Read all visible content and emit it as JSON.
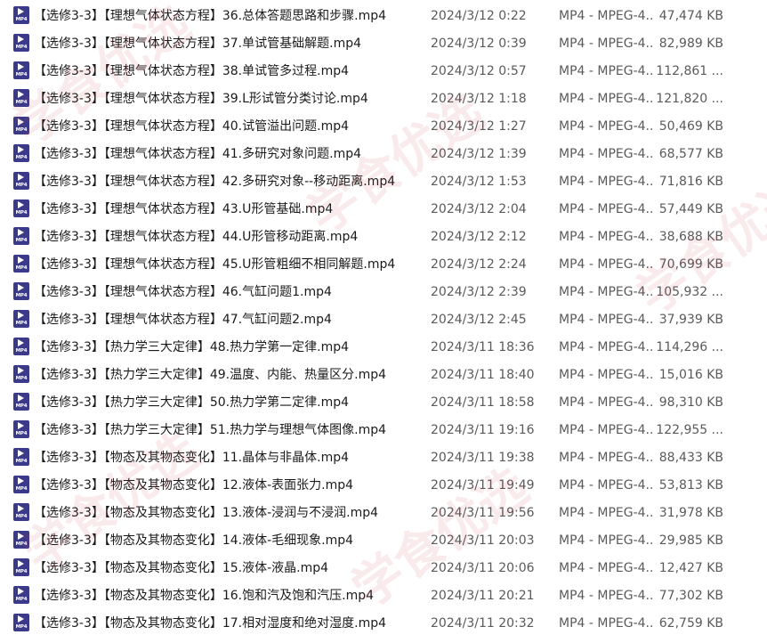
{
  "icon": {
    "name": "mp4-file-icon",
    "label": "MP4",
    "color": "#3b3a8a"
  },
  "files": [
    {
      "name": "【选修3-3】【理想气体状态方程】36.总体答题思路和步骤.mp4",
      "date": "2024/3/12 0:22",
      "type": "MP4 - MPEG-4...",
      "size": "47,474 KB"
    },
    {
      "name": "【选修3-3】【理想气体状态方程】37.单试管基础解题.mp4",
      "date": "2024/3/12 0:39",
      "type": "MP4 - MPEG-4...",
      "size": "82,989 KB"
    },
    {
      "name": "【选修3-3】【理想气体状态方程】38.单试管多过程.mp4",
      "date": "2024/3/12 0:57",
      "type": "MP4 - MPEG-4...",
      "size": "112,861 ..."
    },
    {
      "name": "【选修3-3】【理想气体状态方程】39.L形试管分类讨论.mp4",
      "date": "2024/3/12 1:18",
      "type": "MP4 - MPEG-4...",
      "size": "121,820 ..."
    },
    {
      "name": "【选修3-3】【理想气体状态方程】40.试管溢出问题.mp4",
      "date": "2024/3/12 1:27",
      "type": "MP4 - MPEG-4...",
      "size": "50,469 KB"
    },
    {
      "name": "【选修3-3】【理想气体状态方程】41.多研究对象问题.mp4",
      "date": "2024/3/12 1:39",
      "type": "MP4 - MPEG-4...",
      "size": "68,577 KB"
    },
    {
      "name": "【选修3-3】【理想气体状态方程】42.多研究对象--移动距离.mp4",
      "date": "2024/3/12 1:53",
      "type": "MP4 - MPEG-4...",
      "size": "71,816 KB"
    },
    {
      "name": "【选修3-3】【理想气体状态方程】43.U形管基础.mp4",
      "date": "2024/3/12 2:04",
      "type": "MP4 - MPEG-4...",
      "size": "57,449 KB"
    },
    {
      "name": "【选修3-3】【理想气体状态方程】44.U形管移动距离.mp4",
      "date": "2024/3/12 2:12",
      "type": "MP4 - MPEG-4...",
      "size": "38,688 KB"
    },
    {
      "name": "【选修3-3】【理想气体状态方程】45.U形管粗细不相同解题.mp4",
      "date": "2024/3/12 2:24",
      "type": "MP4 - MPEG-4...",
      "size": "70,699 KB"
    },
    {
      "name": "【选修3-3】【理想气体状态方程】46.气缸问题1.mp4",
      "date": "2024/3/12 2:39",
      "type": "MP4 - MPEG-4...",
      "size": "105,932 ..."
    },
    {
      "name": "【选修3-3】【理想气体状态方程】47.气缸问题2.mp4",
      "date": "2024/3/12 2:45",
      "type": "MP4 - MPEG-4...",
      "size": "37,939 KB"
    },
    {
      "name": "【选修3-3】【热力学三大定律】48.热力学第一定律.mp4",
      "date": "2024/3/11 18:36",
      "type": "MP4 - MPEG-4...",
      "size": "114,296 ..."
    },
    {
      "name": "【选修3-3】【热力学三大定律】49.温度、内能、热量区分.mp4",
      "date": "2024/3/11 18:40",
      "type": "MP4 - MPEG-4...",
      "size": "15,016 KB"
    },
    {
      "name": "【选修3-3】【热力学三大定律】50.热力学第二定律.mp4",
      "date": "2024/3/11 18:58",
      "type": "MP4 - MPEG-4...",
      "size": "98,310 KB"
    },
    {
      "name": "【选修3-3】【热力学三大定律】51.热力学与理想气体图像.mp4",
      "date": "2024/3/11 19:16",
      "type": "MP4 - MPEG-4...",
      "size": "122,955 ..."
    },
    {
      "name": "【选修3-3】【物态及其物态变化】11.晶体与非晶体.mp4",
      "date": "2024/3/11 19:38",
      "type": "MP4 - MPEG-4...",
      "size": "88,433 KB"
    },
    {
      "name": "【选修3-3】【物态及其物态变化】12.液体-表面张力.mp4",
      "date": "2024/3/11 19:49",
      "type": "MP4 - MPEG-4...",
      "size": "53,813 KB"
    },
    {
      "name": "【选修3-3】【物态及其物态变化】13.液体-浸润与不浸润.mp4",
      "date": "2024/3/11 19:56",
      "type": "MP4 - MPEG-4...",
      "size": "31,978 KB"
    },
    {
      "name": "【选修3-3】【物态及其物态变化】14.液体-毛细现象.mp4",
      "date": "2024/3/11 20:03",
      "type": "MP4 - MPEG-4...",
      "size": "29,985 KB"
    },
    {
      "name": "【选修3-3】【物态及其物态变化】15.液体-液晶.mp4",
      "date": "2024/3/11 20:06",
      "type": "MP4 - MPEG-4...",
      "size": "12,427 KB"
    },
    {
      "name": "【选修3-3】【物态及其物态变化】16.饱和汽及饱和汽压.mp4",
      "date": "2024/3/11 20:21",
      "type": "MP4 - MPEG-4...",
      "size": "77,302 KB"
    },
    {
      "name": "【选修3-3】【物态及其物态变化】17.相对湿度和绝对湿度.mp4",
      "date": "2024/3/11 20:32",
      "type": "MP4 - MPEG-4...",
      "size": "62,759 KB"
    }
  ],
  "watermark": {
    "text": "学食优选",
    "color": "#c83c3c"
  }
}
